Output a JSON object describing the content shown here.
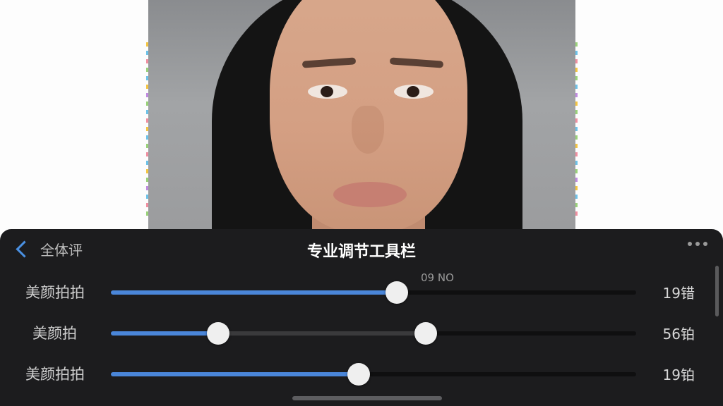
{
  "panel": {
    "back_label": "全体评",
    "title": "专业调节工具栏",
    "tooltip": "09 NO",
    "sliders": [
      {
        "label": "美颜拍拍",
        "value": "19错",
        "level": 0.545
      },
      {
        "label": "美颜拍",
        "value": "56铂",
        "range_low": 0.204,
        "range_high": 0.599
      },
      {
        "label": "美颜拍拍",
        "value": "19铂",
        "level": 0.472
      }
    ]
  },
  "colors": {
    "accent": "#4a86d9",
    "panel_bg": "#1c1c1e",
    "thumb": "#efefef"
  },
  "icons": {
    "back": "chevron-left-icon",
    "more": "ellipsis-icon"
  }
}
